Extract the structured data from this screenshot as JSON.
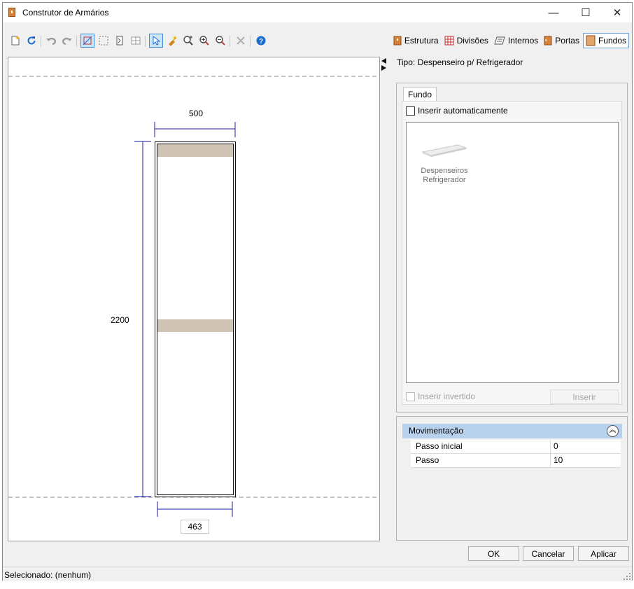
{
  "window": {
    "title": "Construtor de Armários",
    "minimize_glyph": "—",
    "maximize_glyph": "☐",
    "close_glyph": "✕"
  },
  "toolbar": {
    "icons": [
      "new-icon",
      "refresh-icon",
      "undo-icon",
      "redo-icon",
      "edit-structure-icon",
      "select-area-icon",
      "door-icon",
      "grid-icon",
      "pointer-icon",
      "paint-icon",
      "zoom-fit-icon",
      "zoom-in-icon",
      "zoom-out-icon",
      "delete-icon",
      "help-icon"
    ]
  },
  "tabs": [
    {
      "label": "Estrutura",
      "icon": "structure-icon"
    },
    {
      "label": "Divisões",
      "icon": "divisions-icon"
    },
    {
      "label": "Internos",
      "icon": "internals-icon"
    },
    {
      "label": "Portas",
      "icon": "door-icon"
    },
    {
      "label": "Fundos",
      "icon": "back-panel-icon",
      "active": true
    }
  ],
  "drawing": {
    "width_label": "500",
    "height_label": "2200",
    "bottom_width_label": "463"
  },
  "side": {
    "type_label": "Tipo: Despenseiro p/ Refrigerador",
    "tab_label": "Fundo",
    "auto_insert_label": "Inserir automaticamente",
    "item_label_line1": "Despenseiros",
    "item_label_line2": "Refrigerador",
    "inverted_label": "Inserir invertido",
    "insert_button": "Inserir"
  },
  "movement": {
    "header": "Movimentação",
    "rows": [
      {
        "name": "Passo inicial",
        "value": "0"
      },
      {
        "name": "Passo",
        "value": "10"
      }
    ]
  },
  "buttons": {
    "ok": "OK",
    "cancel": "Cancelar",
    "apply": "Aplicar"
  },
  "status": {
    "text": "Selecionado: (nenhum)"
  },
  "colors": {
    "shelf": "#cfc3b3",
    "dimension": "#1a1aa6",
    "accent": "#d9823b",
    "header": "#b8d2ee"
  }
}
